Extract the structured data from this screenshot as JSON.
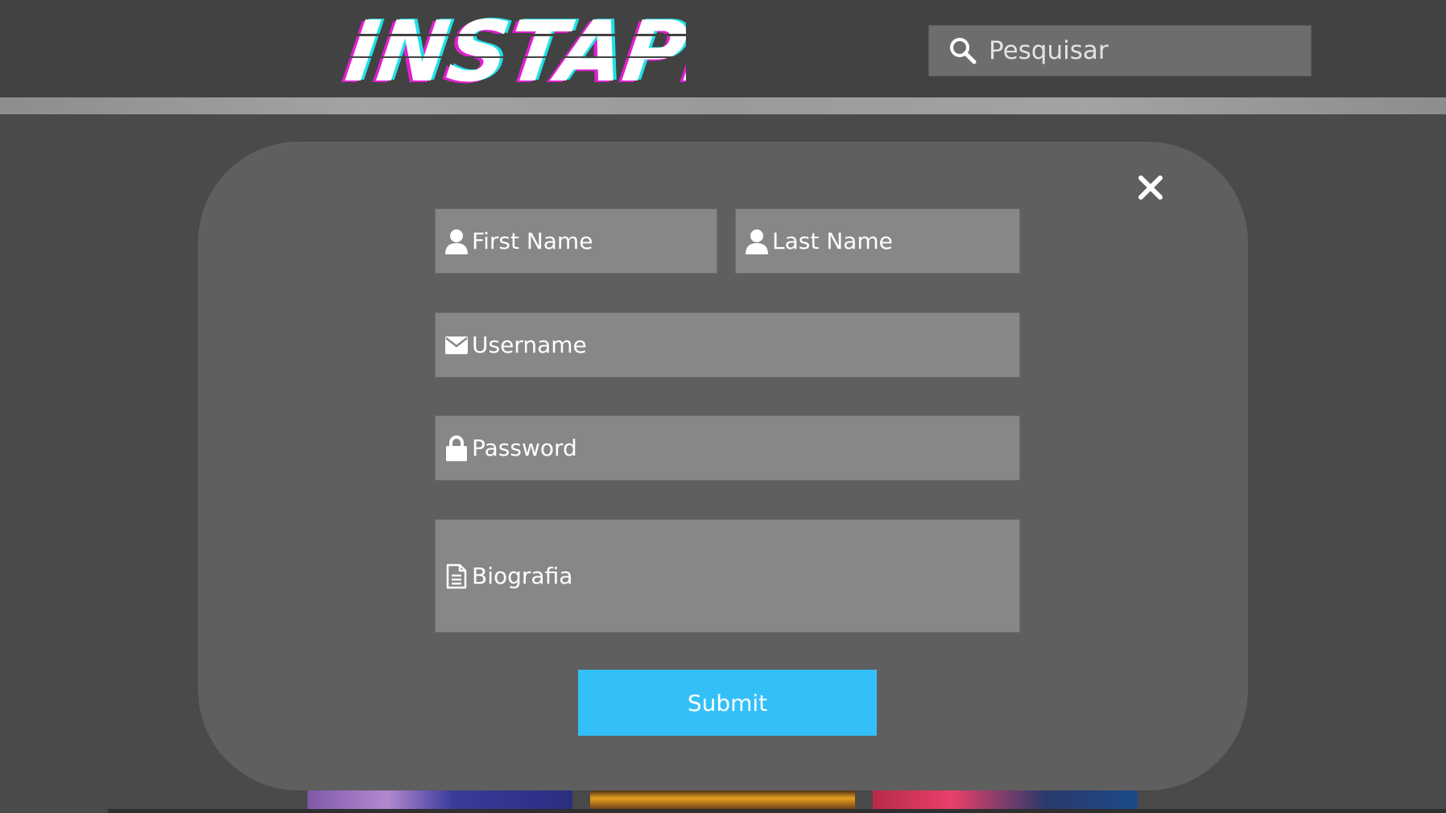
{
  "header": {
    "logo_text": "INSTAPICS",
    "search": {
      "placeholder": "Pesquisar",
      "icon": "search-icon"
    }
  },
  "modal": {
    "close_icon": "close-icon",
    "fields": {
      "first_name": {
        "placeholder": "First Name",
        "icon": "user-icon"
      },
      "last_name": {
        "placeholder": "Last Name",
        "icon": "user-icon"
      },
      "username": {
        "placeholder": "Username",
        "icon": "envelope-icon"
      },
      "password": {
        "placeholder": "Password",
        "icon": "lock-icon"
      },
      "bio": {
        "placeholder": "Biografia",
        "icon": "document-icon"
      }
    },
    "submit_label": "Submit"
  },
  "colors": {
    "header_bg": "#424242",
    "page_bg": "#4a4a4a",
    "modal_bg": "#5f5f5f",
    "field_bg": "#878787",
    "submit_bg": "#33c0f8",
    "logo_glitch_magenta": "#e020d0",
    "logo_glitch_cyan": "#20e0e8"
  }
}
